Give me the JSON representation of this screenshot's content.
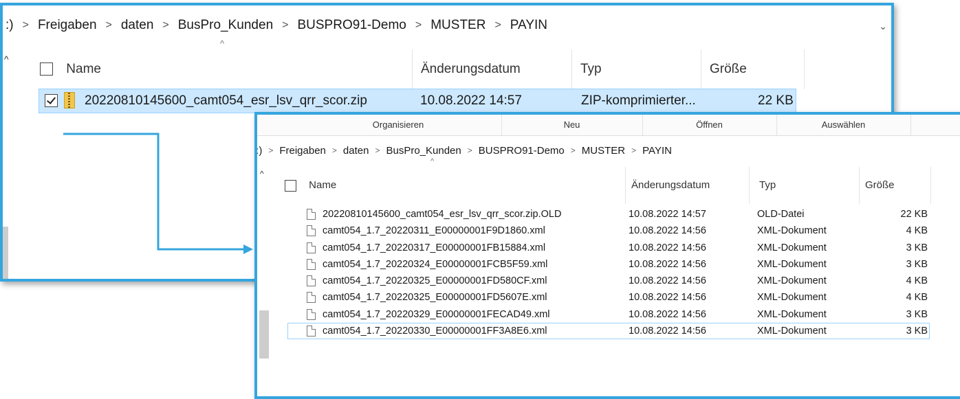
{
  "window1": {
    "breadcrumb": [
      ":)",
      "Freigaben",
      "daten",
      "BusPro_Kunden",
      "BUSPRO91-Demo",
      "MUSTER",
      "PAYIN"
    ],
    "columns": {
      "name": "Name",
      "date": "Änderungsdatum",
      "type": "Typ",
      "size": "Größe"
    },
    "file": {
      "name": "20220810145600_camt054_esr_lsv_qrr_scor.zip",
      "date": "10.08.2022 14:57",
      "type": "ZIP-komprimierter...",
      "size": "22 KB",
      "checked": true
    }
  },
  "window2": {
    "ribbon": [
      "Organisieren",
      "Neu",
      "Öffnen",
      "Auswählen"
    ],
    "breadcrumb": [
      "F:)",
      "Freigaben",
      "daten",
      "BusPro_Kunden",
      "BUSPRO91-Demo",
      "MUSTER",
      "PAYIN"
    ],
    "columns": {
      "name": "Name",
      "date": "Änderungsdatum",
      "type": "Typ",
      "size": "Größe"
    },
    "files": [
      {
        "name": "20220810145600_camt054_esr_lsv_qrr_scor.zip.OLD",
        "date": "10.08.2022 14:57",
        "type": "OLD-Datei",
        "size": "22 KB"
      },
      {
        "name": "camt054_1.7_20220311_E00000001F9D1860.xml",
        "date": "10.08.2022 14:56",
        "type": "XML-Dokument",
        "size": "4 KB"
      },
      {
        "name": "camt054_1.7_20220317_E00000001FB15884.xml",
        "date": "10.08.2022 14:56",
        "type": "XML-Dokument",
        "size": "3 KB"
      },
      {
        "name": "camt054_1.7_20220324_E00000001FCB5F59.xml",
        "date": "10.08.2022 14:56",
        "type": "XML-Dokument",
        "size": "3 KB"
      },
      {
        "name": "camt054_1.7_20220325_E00000001FD580CF.xml",
        "date": "10.08.2022 14:56",
        "type": "XML-Dokument",
        "size": "4 KB"
      },
      {
        "name": "camt054_1.7_20220325_E00000001FD5607E.xml",
        "date": "10.08.2022 14:56",
        "type": "XML-Dokument",
        "size": "4 KB"
      },
      {
        "name": "camt054_1.7_20220329_E00000001FECAD49.xml",
        "date": "10.08.2022 14:56",
        "type": "XML-Dokument",
        "size": "3 KB"
      },
      {
        "name": "camt054_1.7_20220330_E00000001FF3A8E6.xml",
        "date": "10.08.2022 14:56",
        "type": "XML-Dokument",
        "size": "3 KB",
        "selected": true
      }
    ]
  },
  "colors": {
    "frame": "#35a5de",
    "selection": "#cce8ff"
  },
  "icons": {
    "zip": "zip-folder-icon",
    "file": "file-icon"
  }
}
